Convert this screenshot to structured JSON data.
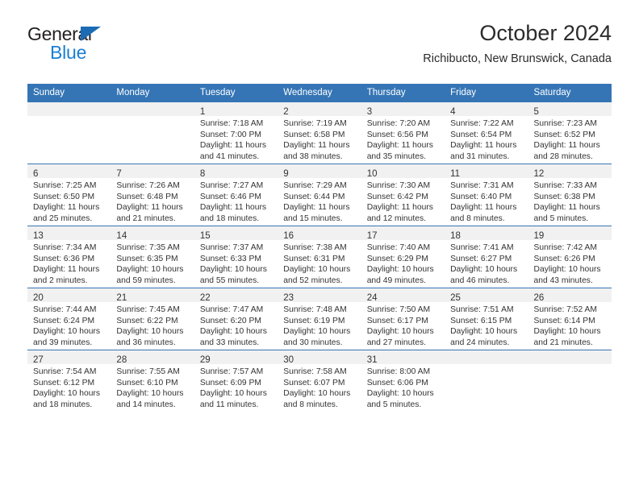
{
  "brand": {
    "name_part1": "General",
    "name_part2": "Blue",
    "triangle_icon": "blue-triangle-icon"
  },
  "header": {
    "title": "October 2024",
    "subtitle": "Richibucto, New Brunswick, Canada"
  },
  "colors": {
    "header_blue": "#3575b5",
    "brand_blue": "#1b7fd4",
    "daynum_band": "#f1f1f1",
    "text": "#333333"
  },
  "weekday_headers": [
    "Sunday",
    "Monday",
    "Tuesday",
    "Wednesday",
    "Thursday",
    "Friday",
    "Saturday"
  ],
  "labels": {
    "sunrise_prefix": "Sunrise: ",
    "sunset_prefix": "Sunset: ",
    "daylight_prefix": "Daylight: "
  },
  "weeks": [
    [
      {
        "day": "",
        "sunrise": "",
        "sunset": "",
        "daylight_line1": "",
        "daylight_line2": "",
        "empty": true
      },
      {
        "day": "",
        "sunrise": "",
        "sunset": "",
        "daylight_line1": "",
        "daylight_line2": "",
        "empty": true
      },
      {
        "day": "1",
        "sunrise": "Sunrise: 7:18 AM",
        "sunset": "Sunset: 7:00 PM",
        "daylight_line1": "Daylight: 11 hours",
        "daylight_line2": "and 41 minutes.",
        "empty": false
      },
      {
        "day": "2",
        "sunrise": "Sunrise: 7:19 AM",
        "sunset": "Sunset: 6:58 PM",
        "daylight_line1": "Daylight: 11 hours",
        "daylight_line2": "and 38 minutes.",
        "empty": false
      },
      {
        "day": "3",
        "sunrise": "Sunrise: 7:20 AM",
        "sunset": "Sunset: 6:56 PM",
        "daylight_line1": "Daylight: 11 hours",
        "daylight_line2": "and 35 minutes.",
        "empty": false
      },
      {
        "day": "4",
        "sunrise": "Sunrise: 7:22 AM",
        "sunset": "Sunset: 6:54 PM",
        "daylight_line1": "Daylight: 11 hours",
        "daylight_line2": "and 31 minutes.",
        "empty": false
      },
      {
        "day": "5",
        "sunrise": "Sunrise: 7:23 AM",
        "sunset": "Sunset: 6:52 PM",
        "daylight_line1": "Daylight: 11 hours",
        "daylight_line2": "and 28 minutes.",
        "empty": false
      }
    ],
    [
      {
        "day": "6",
        "sunrise": "Sunrise: 7:25 AM",
        "sunset": "Sunset: 6:50 PM",
        "daylight_line1": "Daylight: 11 hours",
        "daylight_line2": "and 25 minutes.",
        "empty": false
      },
      {
        "day": "7",
        "sunrise": "Sunrise: 7:26 AM",
        "sunset": "Sunset: 6:48 PM",
        "daylight_line1": "Daylight: 11 hours",
        "daylight_line2": "and 21 minutes.",
        "empty": false
      },
      {
        "day": "8",
        "sunrise": "Sunrise: 7:27 AM",
        "sunset": "Sunset: 6:46 PM",
        "daylight_line1": "Daylight: 11 hours",
        "daylight_line2": "and 18 minutes.",
        "empty": false
      },
      {
        "day": "9",
        "sunrise": "Sunrise: 7:29 AM",
        "sunset": "Sunset: 6:44 PM",
        "daylight_line1": "Daylight: 11 hours",
        "daylight_line2": "and 15 minutes.",
        "empty": false
      },
      {
        "day": "10",
        "sunrise": "Sunrise: 7:30 AM",
        "sunset": "Sunset: 6:42 PM",
        "daylight_line1": "Daylight: 11 hours",
        "daylight_line2": "and 12 minutes.",
        "empty": false
      },
      {
        "day": "11",
        "sunrise": "Sunrise: 7:31 AM",
        "sunset": "Sunset: 6:40 PM",
        "daylight_line1": "Daylight: 11 hours",
        "daylight_line2": "and 8 minutes.",
        "empty": false
      },
      {
        "day": "12",
        "sunrise": "Sunrise: 7:33 AM",
        "sunset": "Sunset: 6:38 PM",
        "daylight_line1": "Daylight: 11 hours",
        "daylight_line2": "and 5 minutes.",
        "empty": false
      }
    ],
    [
      {
        "day": "13",
        "sunrise": "Sunrise: 7:34 AM",
        "sunset": "Sunset: 6:36 PM",
        "daylight_line1": "Daylight: 11 hours",
        "daylight_line2": "and 2 minutes.",
        "empty": false
      },
      {
        "day": "14",
        "sunrise": "Sunrise: 7:35 AM",
        "sunset": "Sunset: 6:35 PM",
        "daylight_line1": "Daylight: 10 hours",
        "daylight_line2": "and 59 minutes.",
        "empty": false
      },
      {
        "day": "15",
        "sunrise": "Sunrise: 7:37 AM",
        "sunset": "Sunset: 6:33 PM",
        "daylight_line1": "Daylight: 10 hours",
        "daylight_line2": "and 55 minutes.",
        "empty": false
      },
      {
        "day": "16",
        "sunrise": "Sunrise: 7:38 AM",
        "sunset": "Sunset: 6:31 PM",
        "daylight_line1": "Daylight: 10 hours",
        "daylight_line2": "and 52 minutes.",
        "empty": false
      },
      {
        "day": "17",
        "sunrise": "Sunrise: 7:40 AM",
        "sunset": "Sunset: 6:29 PM",
        "daylight_line1": "Daylight: 10 hours",
        "daylight_line2": "and 49 minutes.",
        "empty": false
      },
      {
        "day": "18",
        "sunrise": "Sunrise: 7:41 AM",
        "sunset": "Sunset: 6:27 PM",
        "daylight_line1": "Daylight: 10 hours",
        "daylight_line2": "and 46 minutes.",
        "empty": false
      },
      {
        "day": "19",
        "sunrise": "Sunrise: 7:42 AM",
        "sunset": "Sunset: 6:26 PM",
        "daylight_line1": "Daylight: 10 hours",
        "daylight_line2": "and 43 minutes.",
        "empty": false
      }
    ],
    [
      {
        "day": "20",
        "sunrise": "Sunrise: 7:44 AM",
        "sunset": "Sunset: 6:24 PM",
        "daylight_line1": "Daylight: 10 hours",
        "daylight_line2": "and 39 minutes.",
        "empty": false
      },
      {
        "day": "21",
        "sunrise": "Sunrise: 7:45 AM",
        "sunset": "Sunset: 6:22 PM",
        "daylight_line1": "Daylight: 10 hours",
        "daylight_line2": "and 36 minutes.",
        "empty": false
      },
      {
        "day": "22",
        "sunrise": "Sunrise: 7:47 AM",
        "sunset": "Sunset: 6:20 PM",
        "daylight_line1": "Daylight: 10 hours",
        "daylight_line2": "and 33 minutes.",
        "empty": false
      },
      {
        "day": "23",
        "sunrise": "Sunrise: 7:48 AM",
        "sunset": "Sunset: 6:19 PM",
        "daylight_line1": "Daylight: 10 hours",
        "daylight_line2": "and 30 minutes.",
        "empty": false
      },
      {
        "day": "24",
        "sunrise": "Sunrise: 7:50 AM",
        "sunset": "Sunset: 6:17 PM",
        "daylight_line1": "Daylight: 10 hours",
        "daylight_line2": "and 27 minutes.",
        "empty": false
      },
      {
        "day": "25",
        "sunrise": "Sunrise: 7:51 AM",
        "sunset": "Sunset: 6:15 PM",
        "daylight_line1": "Daylight: 10 hours",
        "daylight_line2": "and 24 minutes.",
        "empty": false
      },
      {
        "day": "26",
        "sunrise": "Sunrise: 7:52 AM",
        "sunset": "Sunset: 6:14 PM",
        "daylight_line1": "Daylight: 10 hours",
        "daylight_line2": "and 21 minutes.",
        "empty": false
      }
    ],
    [
      {
        "day": "27",
        "sunrise": "Sunrise: 7:54 AM",
        "sunset": "Sunset: 6:12 PM",
        "daylight_line1": "Daylight: 10 hours",
        "daylight_line2": "and 18 minutes.",
        "empty": false
      },
      {
        "day": "28",
        "sunrise": "Sunrise: 7:55 AM",
        "sunset": "Sunset: 6:10 PM",
        "daylight_line1": "Daylight: 10 hours",
        "daylight_line2": "and 14 minutes.",
        "empty": false
      },
      {
        "day": "29",
        "sunrise": "Sunrise: 7:57 AM",
        "sunset": "Sunset: 6:09 PM",
        "daylight_line1": "Daylight: 10 hours",
        "daylight_line2": "and 11 minutes.",
        "empty": false
      },
      {
        "day": "30",
        "sunrise": "Sunrise: 7:58 AM",
        "sunset": "Sunset: 6:07 PM",
        "daylight_line1": "Daylight: 10 hours",
        "daylight_line2": "and 8 minutes.",
        "empty": false
      },
      {
        "day": "31",
        "sunrise": "Sunrise: 8:00 AM",
        "sunset": "Sunset: 6:06 PM",
        "daylight_line1": "Daylight: 10 hours",
        "daylight_line2": "and 5 minutes.",
        "empty": false
      },
      {
        "day": "",
        "sunrise": "",
        "sunset": "",
        "daylight_line1": "",
        "daylight_line2": "",
        "empty": true
      },
      {
        "day": "",
        "sunrise": "",
        "sunset": "",
        "daylight_line1": "",
        "daylight_line2": "",
        "empty": true
      }
    ]
  ]
}
